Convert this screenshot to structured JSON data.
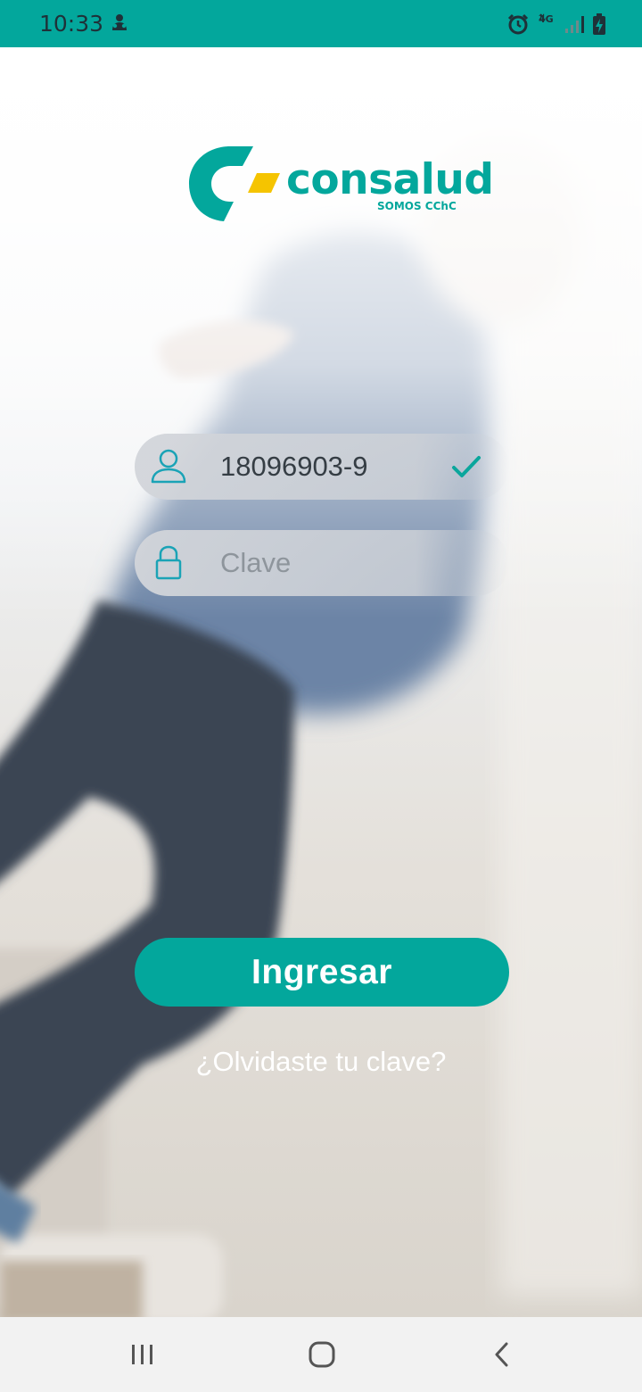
{
  "status_bar": {
    "time": "10:33",
    "left_icon": "notification-icon",
    "network_type": "4G",
    "icons": [
      "alarm-icon",
      "network-4g-icon",
      "signal-icon",
      "battery-charging-icon"
    ]
  },
  "brand": {
    "name": "consalud",
    "tagline": "SOMOS CChC",
    "primary_color": "#03a79c",
    "accent_color": "#f5c400"
  },
  "login_form": {
    "user_field": {
      "icon": "user-icon",
      "value": "18096903-9",
      "status_icon": "checkmark-icon"
    },
    "password_field": {
      "icon": "lock-icon",
      "placeholder": "Clave",
      "value": ""
    },
    "submit_label": "Ingresar",
    "forgot_label": "¿Olvidaste tu clave?"
  },
  "nav_bar": {
    "recent_icon": "recent-apps-icon",
    "home_icon": "home-icon",
    "back_icon": "back-icon"
  }
}
